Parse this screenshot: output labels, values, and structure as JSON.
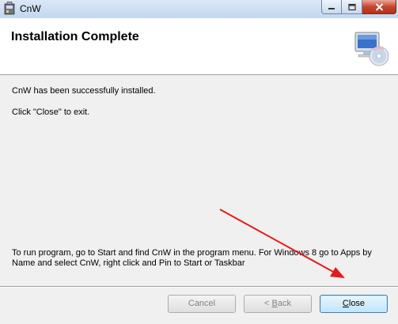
{
  "window": {
    "title": "CnW"
  },
  "banner": {
    "title": "Installation Complete"
  },
  "content": {
    "line1": "CnW has been successfully installed.",
    "line2": "Click \"Close\" to exit.",
    "info_line1": "To run program, go to Start and find CnW in the program menu.  For Windows 8 go to Apps by",
    "info_line2": "Name and select CnW, right click and Pin to Start or Taskbar"
  },
  "buttons": {
    "cancel": "Cancel",
    "back_accel": "B",
    "back_rest": "ack",
    "back_prefix": "< ",
    "close_accel": "C",
    "close_rest": "lose"
  },
  "colors": {
    "annotation_arrow": "#e31b1b"
  }
}
